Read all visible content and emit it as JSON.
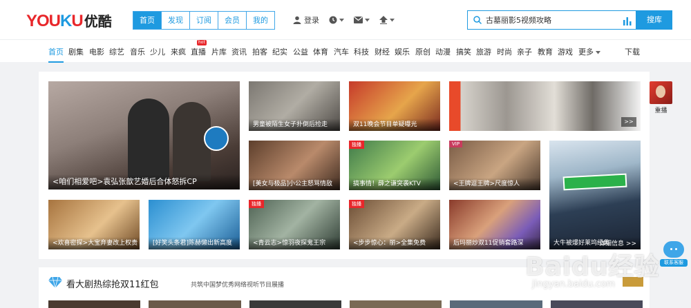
{
  "logo": {
    "part1": "YOU",
    "part2": "K",
    "part3": "U",
    "cn": "优酷"
  },
  "topnav": [
    "首页",
    "发现",
    "订阅",
    "会员",
    "我的"
  ],
  "tools": {
    "login": "登录"
  },
  "search": {
    "value": "古墓丽影5视频攻略",
    "button": "搜库"
  },
  "categories": [
    "首页",
    "剧集",
    "电影",
    "综艺",
    "音乐",
    "少儿",
    "来疯",
    "直播",
    "片库",
    "资讯",
    "拍客",
    "纪实",
    "公益",
    "体育",
    "汽车",
    "科技",
    "财经",
    "娱乐",
    "原创",
    "动漫",
    "搞笑",
    "旅游",
    "时尚",
    "亲子",
    "教育",
    "游戏",
    "更多"
  ],
  "hot_badge": "hot",
  "download": "下载",
  "tiles": [
    {
      "caption": "<咱们相爱吧>袁弘张歆艺婚后合体怒拆CP",
      "tag": ""
    },
    {
      "caption": "男童被陌生女子扑倒后捡走",
      "tag": ""
    },
    {
      "caption": "双11晚会节目单疑曝光",
      "tag": ""
    },
    {
      "caption": "",
      "tag": ""
    },
    {
      "caption": "[美女与极品]小公主怒骂情敌",
      "tag": ""
    },
    {
      "caption": "搞事情！薛之谦突袭KTV",
      "tag": "独播"
    },
    {
      "caption": "<王牌逗王牌>尺度惊人",
      "tag": "VIP"
    },
    {
      "caption": "<欢喜密探>大宝弃妻改上权贵",
      "tag": ""
    },
    {
      "caption": "[好笑头条君]陈赫懒出新高度",
      "tag": ""
    },
    {
      "caption": "<青云志>惊羽夜探鬼王宗",
      "tag": "独播"
    },
    {
      "caption": "<步步惊心：丽>全集免费",
      "tag": "独播"
    },
    {
      "caption": "后玛丽炒双11促销套路深",
      "tag": ""
    },
    {
      "caption": "大牛被爆好莱坞经典",
      "tag": ""
    }
  ],
  "more_btn": ">>",
  "detail_link": "详细信息 >>",
  "replay": "重播",
  "kefu": "联系客服",
  "section": {
    "title": "看大剧热综抢双11红包",
    "subtitle": "共筑中国梦优秀网络视听节目展播"
  },
  "watermark": {
    "main": "Baidu经验",
    "sub": "jingyan.baidu.com"
  },
  "colors": {
    "brand_blue": "#1e9ae0",
    "brand_red": "#e8272b"
  }
}
